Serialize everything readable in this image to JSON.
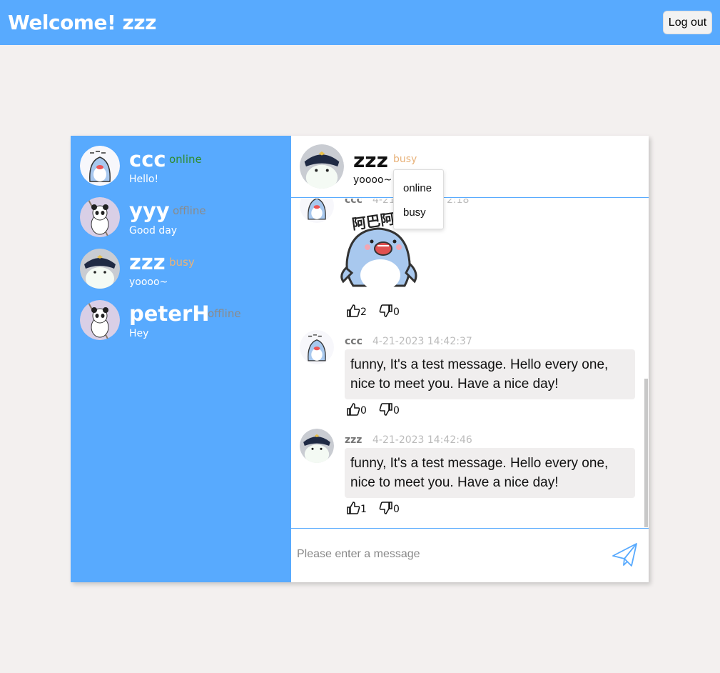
{
  "header": {
    "welcome": "Welcome! zzz",
    "logout_label": "Log out"
  },
  "colors": {
    "accent": "#58aafe",
    "online": "#2e8b2e",
    "offline": "#8a8a8a",
    "busy": "#e8b27a"
  },
  "contacts": [
    {
      "name": "ccc",
      "status": "online",
      "last_message": "Hello!",
      "avatar": "shark-avatar"
    },
    {
      "name": "yyy",
      "status": "offline",
      "last_message": "Good day",
      "avatar": "panda-avatar"
    },
    {
      "name": "zzz",
      "status": "busy",
      "last_message": "yoooo~",
      "avatar": "pilot-avatar"
    },
    {
      "name": "peterH",
      "status": "offline",
      "last_message": "Hey",
      "avatar": "panda-avatar"
    }
  ],
  "chat": {
    "name": "zzz",
    "status": "busy",
    "last_message": "yoooo~",
    "messages": [
      {
        "sender": "ccc",
        "time": "4-21-2023 14:42:18",
        "sticker_text": "阿巴阿巴",
        "likes": "2",
        "dislikes": "0"
      },
      {
        "sender": "ccc",
        "time": "4-21-2023 14:42:37",
        "text": "funny, It's a test message. Hello every one, nice to meet you. Have a nice day!",
        "likes": "0",
        "dislikes": "0"
      },
      {
        "sender": "zzz",
        "time": "4-21-2023 14:42:46",
        "text": "funny, It's a test message. Hello every one, nice to meet you. Have a nice day!",
        "likes": "1",
        "dislikes": "0"
      }
    ],
    "visible_partial_header": {
      "sender": "ccc",
      "time_fragment_1": "4-21",
      "time_fragment_2": "2:18"
    }
  },
  "status_menu": {
    "options": [
      "online",
      "busy"
    ]
  },
  "composer": {
    "placeholder": "Please enter a message"
  },
  "icons": {
    "like": "thumbs-up-icon",
    "dislike": "thumbs-down-icon",
    "send": "paper-plane-icon"
  }
}
